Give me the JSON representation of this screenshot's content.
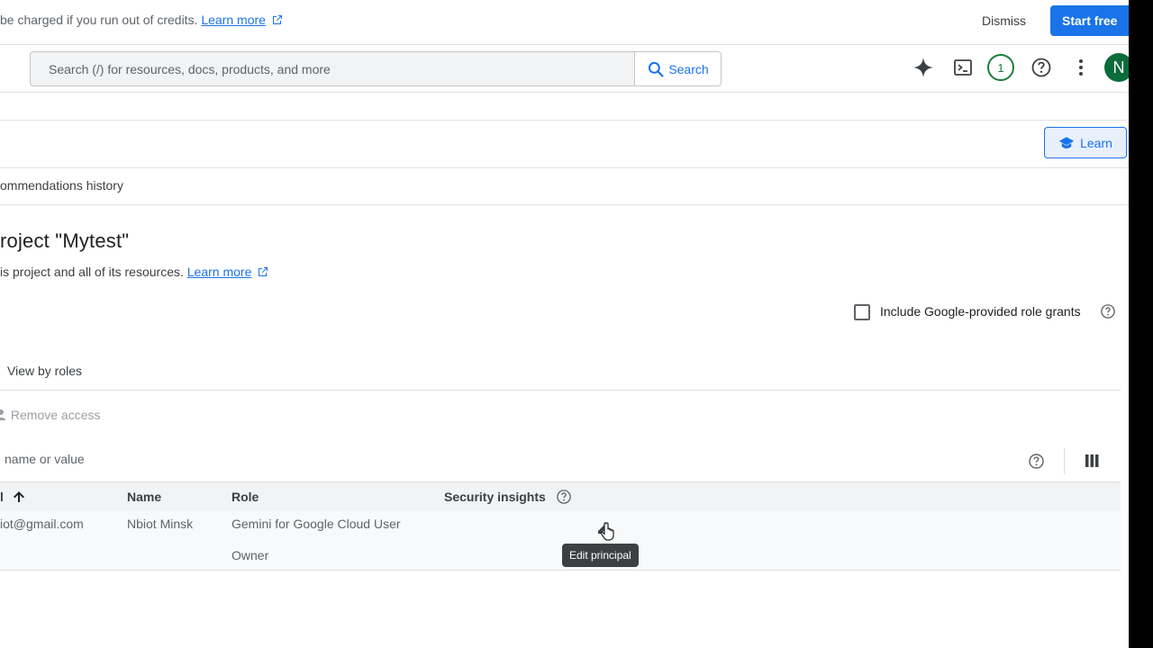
{
  "banner": {
    "text": "be charged if you run out of credits.",
    "learn_more": "Learn more",
    "dismiss_label": "Dismiss",
    "start_label": "Start free"
  },
  "search": {
    "placeholder": "Search (/) for resources, docs, products, and more",
    "button_label": "Search"
  },
  "header": {
    "notification_count": "1",
    "avatar_initial": "N"
  },
  "toolbar": {
    "learn_label": "Learn"
  },
  "tabs": {
    "history_label": "ommendations history"
  },
  "page": {
    "title": "roject \"Mytest\"",
    "description": "is project and all of its resources.",
    "learn_more": "Learn more"
  },
  "options": {
    "include_google_label": "Include Google-provided role grants"
  },
  "view": {
    "view_by_roles": "View by roles"
  },
  "actions": {
    "remove_access": "Remove access"
  },
  "filter": {
    "text": "name or value"
  },
  "table": {
    "columns": {
      "principal": "l",
      "name": "Name",
      "role": "Role",
      "security": "Security insights"
    },
    "rows": [
      {
        "principal": "iot@gmail.com",
        "name": "Nbiot Minsk",
        "roles": [
          "Gemini for Google Cloud User",
          "Owner"
        ]
      }
    ]
  },
  "tooltip": {
    "text": "Edit principal"
  },
  "colors": {
    "accent": "#1a73e8",
    "success": "#188038",
    "avatar_bg": "#0b6b3a"
  }
}
